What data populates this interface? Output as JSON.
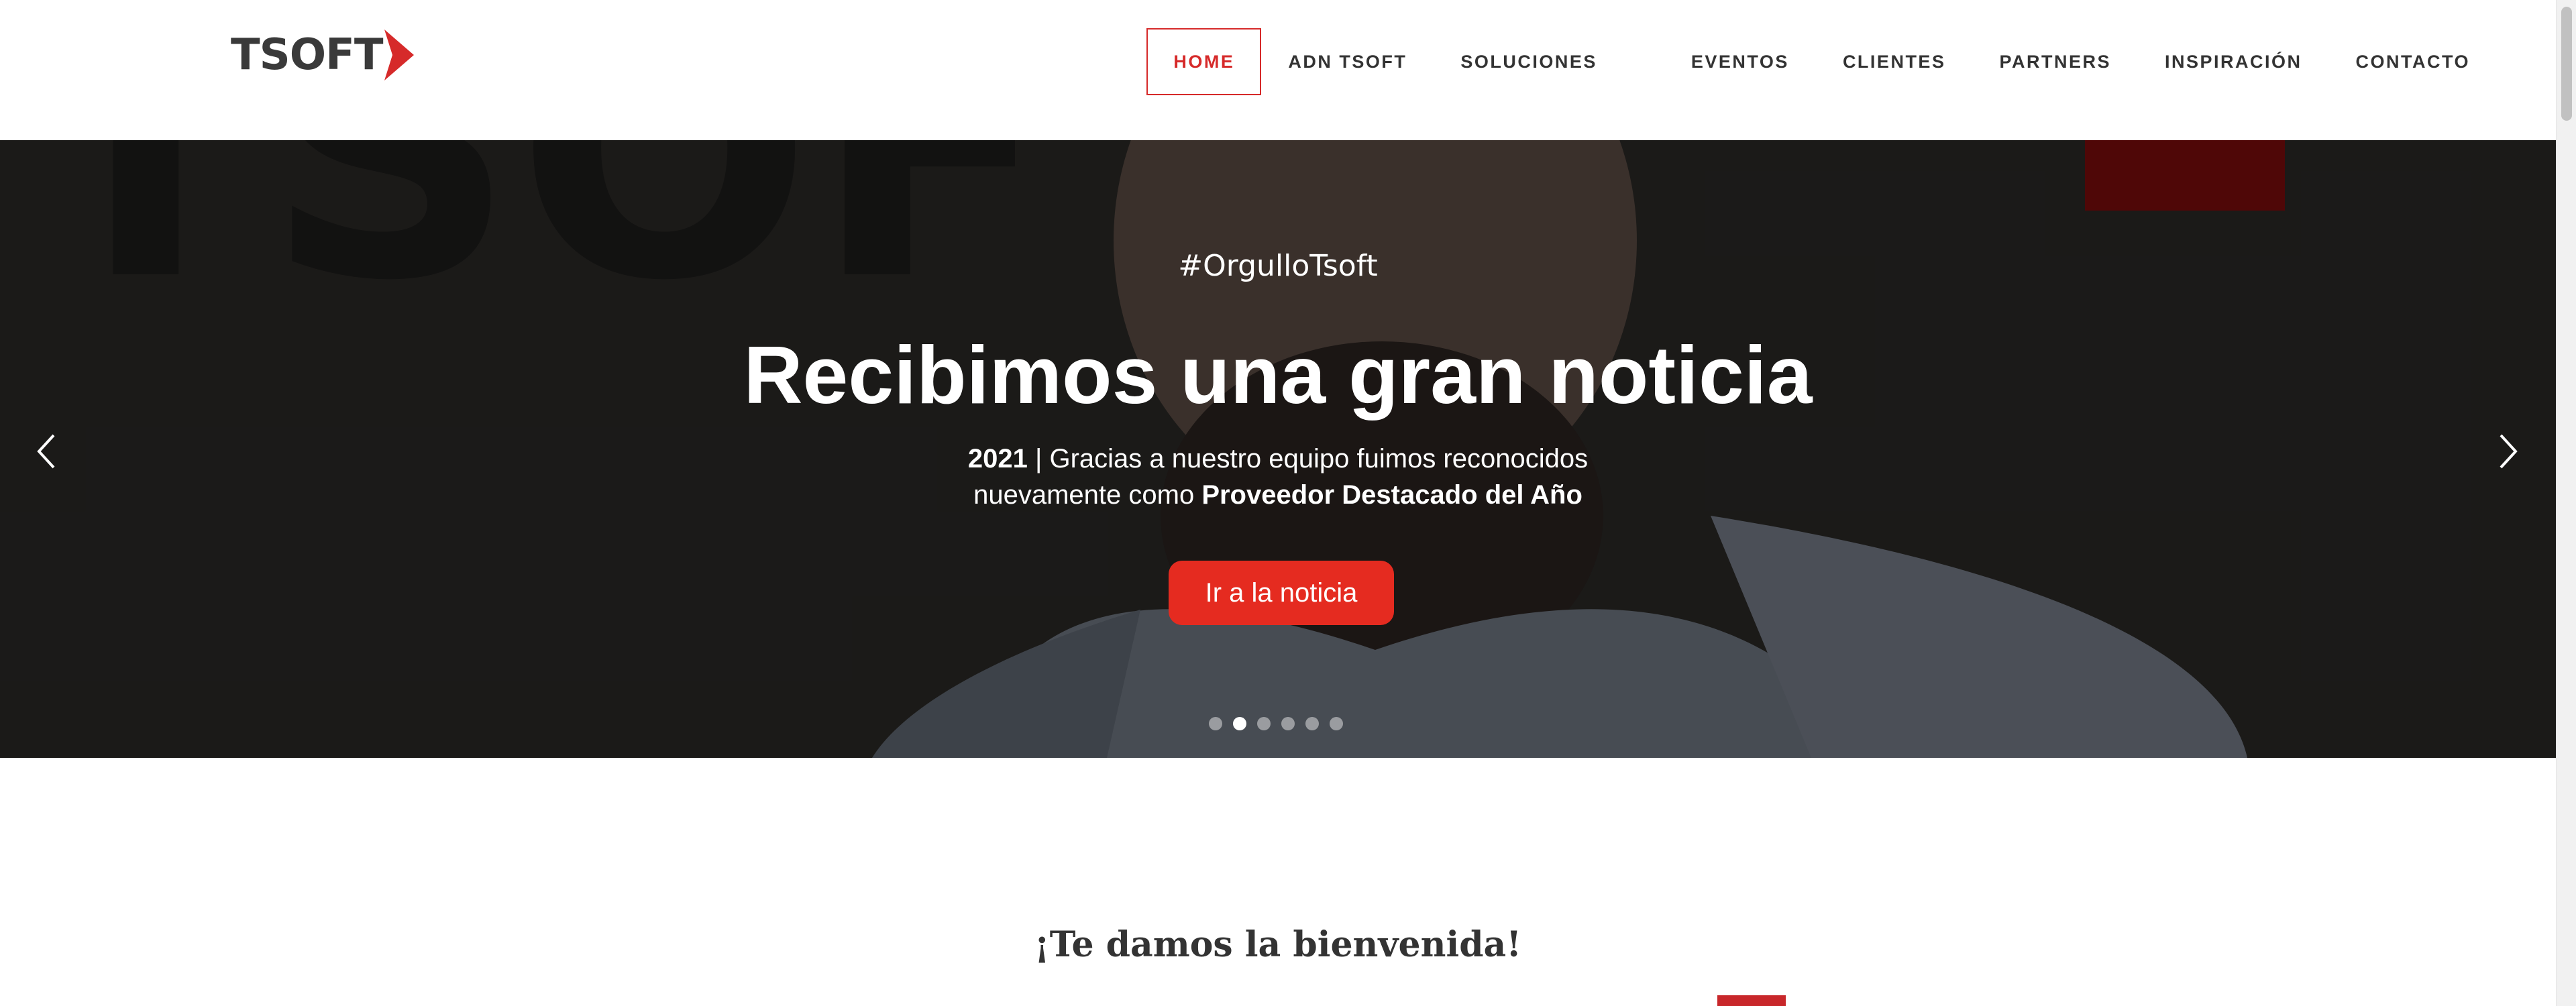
{
  "header": {
    "logo": {
      "text": "TSOFT",
      "icon": "red-chevron-icon"
    },
    "nav": [
      {
        "label": "HOME",
        "active": true
      },
      {
        "label": "ADN TSOFT"
      },
      {
        "label": "SOLUCIONES"
      },
      {
        "label": "EVENTOS"
      },
      {
        "label": "CLIENTES"
      },
      {
        "label": "PARTNERS"
      },
      {
        "label": "INSPIRACIÓN"
      },
      {
        "label": "CONTACTO"
      }
    ]
  },
  "hero": {
    "hashtag": "#OrgulloTsoft",
    "title": "Recibimos una gran noticia",
    "subtitle": {
      "year": "2021",
      "line1_rest": " | Gracias a nuestro equipo fuimos reconocidos",
      "line2_prefix": "nuevamente como ",
      "line2_bold": "Proveedor Destacado del Año"
    },
    "button_label": "Ir a la noticia",
    "prev_icon": "chevron-left-icon",
    "next_icon": "chevron-right-icon",
    "slides_count": 6,
    "active_slide": 2
  },
  "welcome": {
    "title": "¡Te damos la bienvenida!"
  },
  "colors": {
    "accent": "#e52b20",
    "active_nav": "#d62a2a",
    "text_dark": "#333333"
  }
}
